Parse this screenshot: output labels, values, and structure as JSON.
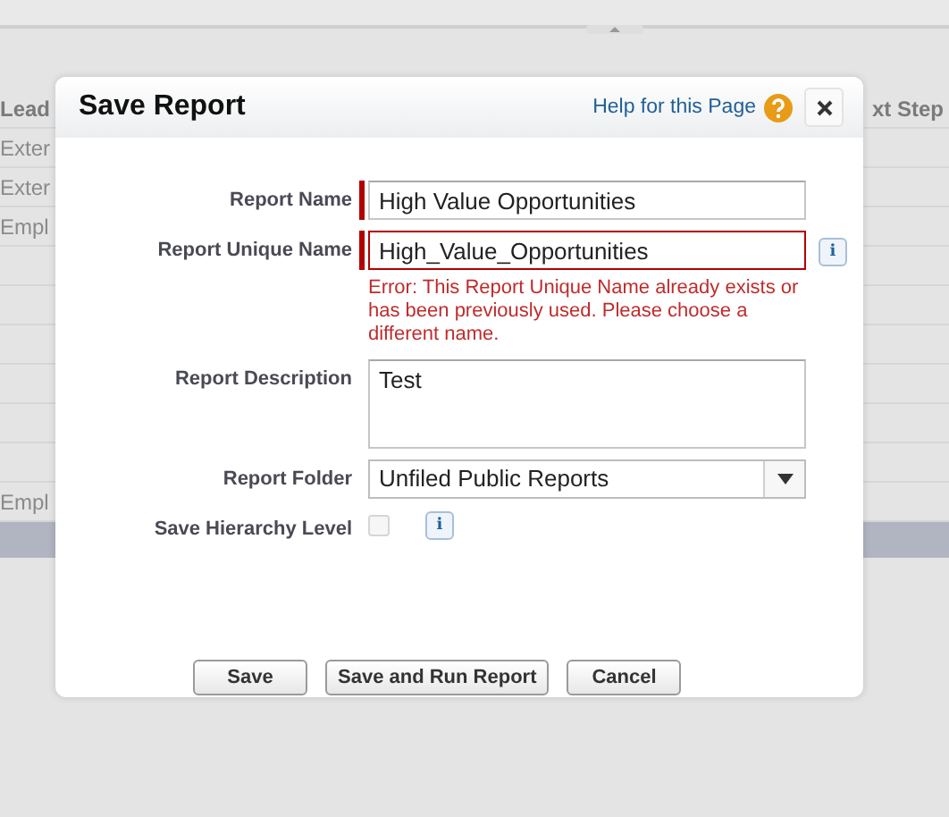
{
  "background_table": {
    "columns": [
      "Lead",
      "xt Step"
    ],
    "rows": [
      {
        "column_1": "Exter"
      },
      {
        "column_1": "Exter"
      },
      {
        "column_1": "Empl"
      },
      {},
      {},
      {},
      {},
      {},
      {},
      {
        "column_1": "Empl"
      }
    ]
  },
  "dialog": {
    "title": "Save Report",
    "help_link": "Help for this Page",
    "fields": [
      {
        "kind": "text",
        "label": "Report Name",
        "value": "High Value Opportunities",
        "required": true
      },
      {
        "kind": "text",
        "label": "Report Unique Name",
        "value": "High_Value_Opportunities",
        "required": true,
        "info_icon": "i",
        "error": "Error: This Report Unique Name already exists or has been previously used. Please choose a different name."
      },
      {
        "kind": "textarea",
        "label": "Report Description",
        "value": "Test",
        "required": false
      },
      {
        "kind": "select",
        "label": "Report Folder",
        "value": "Unfiled Public Reports",
        "required": false
      },
      {
        "kind": "checkbox",
        "label": "Save Hierarchy Level",
        "checked": false,
        "disabled": true,
        "required": false,
        "info_icon": "i"
      }
    ],
    "buttons": [
      "Save",
      "Save and Run Report",
      "Cancel"
    ]
  }
}
